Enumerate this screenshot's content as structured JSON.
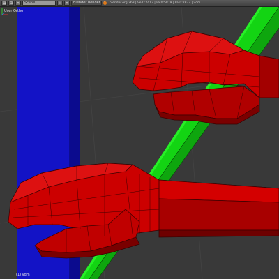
{
  "header": {
    "scene_name": "Scene",
    "render_engine": "Blender Render",
    "stats": "blender.org 263 | Ve:0:2413 | Fa:0:5819 | Fa:0:2837 | vdm"
  },
  "viewport": {
    "view_label": "User Ortho",
    "object_label": "(1) vdm"
  },
  "colors": {
    "background": "#393939",
    "hand_red": "#cc0000",
    "stick_green": "#11c411",
    "pillar_blue": "#1515c8"
  }
}
